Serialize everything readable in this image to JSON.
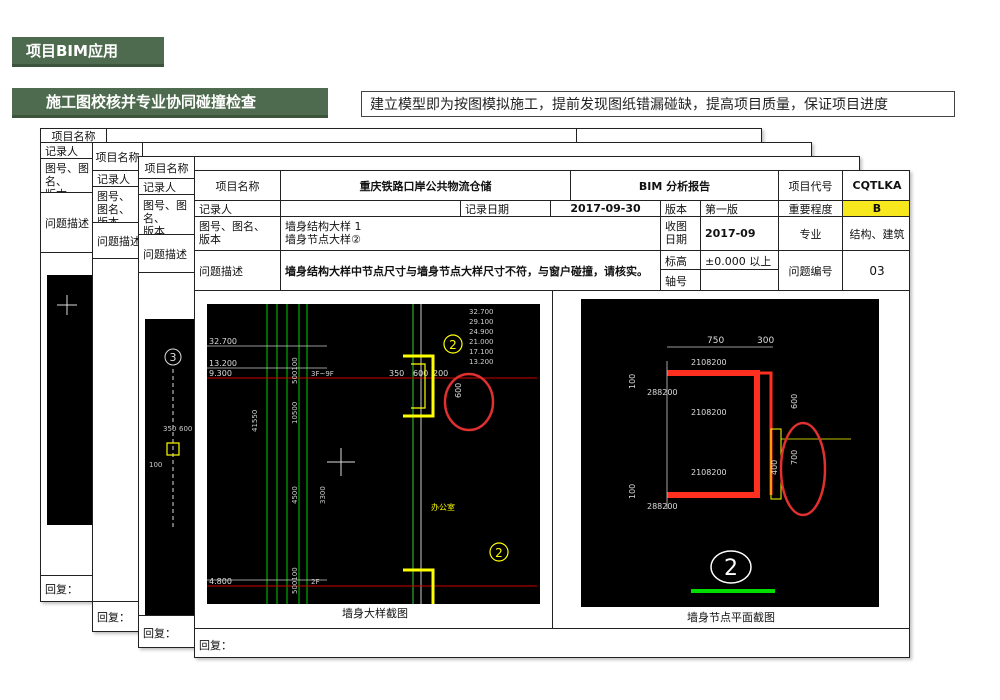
{
  "section_title": "项目BIM应用",
  "subsection_title": "施工图校核并专业协同碰撞检查",
  "description": "建立模型即为按图模拟施工，提前发现图纸错漏碰缺，提高项目质量，保证项目进度",
  "back_sheets": {
    "project_name_label": "项目名称",
    "recorder_label": "记录人",
    "drawing_label_1": "图号、图名、",
    "drawing_label_2": "版本",
    "issue_desc_label": "问题描述",
    "reply_label": "回复："
  },
  "front_sheet": {
    "project_name_label": "项目名称",
    "project_name": "重庆铁路口岸公共物流仓储",
    "report_title": "BIM 分析报告",
    "project_code_label": "项目代号",
    "project_code": "CQTLKA",
    "recorder_label": "记录人",
    "record_date_label": "记录日期",
    "record_date": "2017-09-30",
    "version_label": "版本",
    "version_value": "第一版",
    "importance_label": "重要程度",
    "importance_value": "B",
    "drawing_label_1": "图号、图名、",
    "drawing_label_2": "版本",
    "drawing_1": "墙身结构大样 1",
    "drawing_2": "墙身节点大样②",
    "received_date_label_1": "收图",
    "received_date_label_2": "日期",
    "received_date": "2017-09",
    "discipline_label": "专业",
    "discipline_value": "结构、建筑",
    "issue_desc_label": "问题描述",
    "issue_desc": "墙身结构大样中节点尺寸与墙身节点大样尺寸不符，与窗户碰撞，请核实。",
    "elevation_label": "标高",
    "elevation_value": "±0.000 以上",
    "axis_label": "轴号",
    "issue_no_label": "问题编号",
    "issue_no": "03",
    "caption_left": "墙身大样截图",
    "caption_right": "墙身节点平面截图",
    "reply_label": "回复："
  },
  "cad_left": {
    "elev_labels": [
      "32.700",
      "13.200",
      "9.300",
      "4.800"
    ],
    "dims": [
      "350",
      "600",
      "200",
      "600",
      "41550",
      "4500",
      "3300",
      "10500",
      "500100",
      "500100"
    ],
    "floor_labels": [
      "3F~9F",
      "2F"
    ],
    "room_label": "办公室",
    "bubble": "2",
    "level_table": [
      "32.700",
      "29.100",
      "24.900",
      "21.000",
      "17.100",
      "13.200"
    ]
  },
  "cad_right": {
    "dims": [
      "750",
      "300",
      "600",
      "700",
      "100",
      "100",
      "400"
    ],
    "rebar": [
      "2108200",
      "288200",
      "2108200",
      "2108200",
      "288200"
    ],
    "bubble": "2"
  },
  "cad_back": {
    "bubble": "3",
    "dims": [
      "350",
      "600",
      "100"
    ]
  },
  "colors": {
    "header_bg": "#4f6b4f",
    "highlight": "#f7e81e",
    "cad_bg": "#000000",
    "markup_red": "#e03030"
  }
}
